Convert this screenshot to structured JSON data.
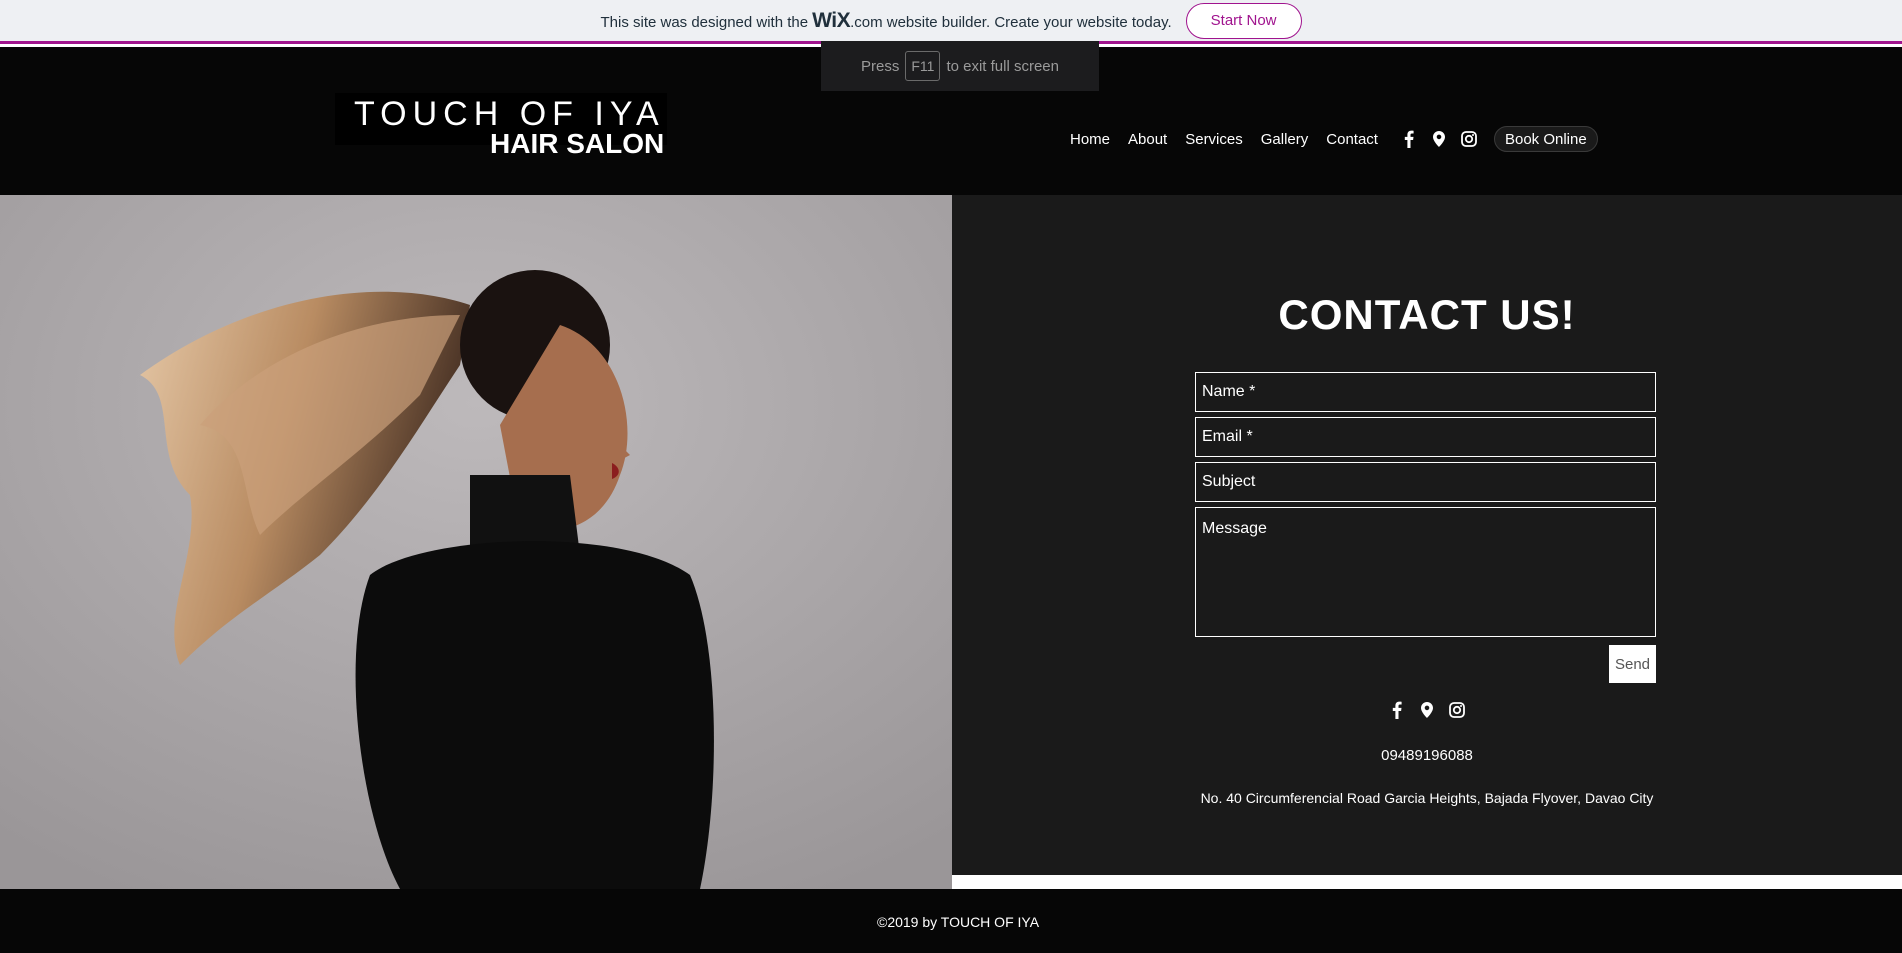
{
  "banner": {
    "text_before": "This site was designed with the",
    "wix_logo": "WiX",
    "text_after": ".com website builder. Create your website today.",
    "button_label": "Start Now",
    "accent_color": "#a0138e"
  },
  "fullscreen_hint": {
    "press": "Press",
    "key": "F11",
    "rest": "to exit full screen"
  },
  "logo": {
    "line1": "TOUCH OF IYA",
    "line2": "HAIR SALON"
  },
  "nav": {
    "items": [
      "Home",
      "About",
      "Services",
      "Gallery",
      "Contact"
    ],
    "social_icons": [
      "facebook-icon",
      "map-pin-icon",
      "instagram-icon"
    ],
    "book_label": "Book Online"
  },
  "contact": {
    "title": "CONTACT US!",
    "fields": {
      "name_placeholder": "Name *",
      "email_placeholder": "Email *",
      "subject_placeholder": "Subject",
      "message_placeholder": "Message"
    },
    "send_label": "Send",
    "social_icons": [
      "facebook-icon",
      "map-pin-icon",
      "instagram-icon"
    ],
    "phone": "09489196088",
    "address": "No. 40 Circumferencial Road Garcia Heights, Bajada Flyover, Davao City"
  },
  "footer": {
    "copyright": "©2019 by TOUCH OF IYA"
  }
}
